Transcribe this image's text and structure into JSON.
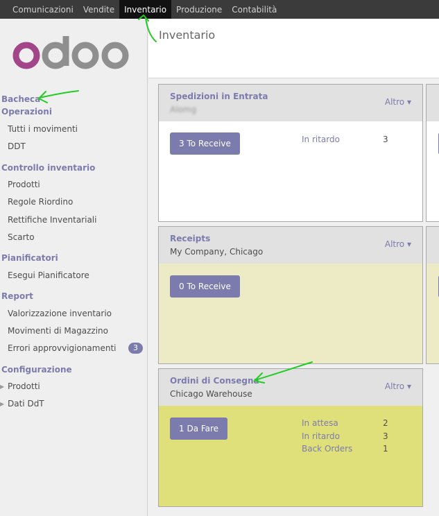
{
  "topbar": {
    "menus": [
      "Comunicazioni",
      "Vendite",
      "Inventario",
      "Produzione",
      "Contabilità"
    ]
  },
  "logo": {
    "text": "odoo",
    "colors": {
      "o1": "#a24689",
      "rest": "#8f8f8f"
    }
  },
  "sidebar": {
    "dashboard": "Bacheca",
    "operations": {
      "title": "Operazioni",
      "items": [
        "Tutti i movimenti",
        "DDT"
      ]
    },
    "inventory_control": {
      "title": "Controllo inventario",
      "items": [
        "Prodotti",
        "Regole Riordino",
        "Rettifiche Inventariali",
        "Scarto"
      ]
    },
    "schedulers": {
      "title": "Pianificatori",
      "items": [
        "Esegui Pianificatore"
      ]
    },
    "reports": {
      "title": "Report",
      "items": [
        "Valorizzazione inventario",
        "Movimenti di Magazzino",
        "Errori approvvigionamenti"
      ],
      "badge": "3"
    },
    "configuration": {
      "title": "Configurazione",
      "items": [
        "Prodotti",
        "Dati DdT"
      ]
    }
  },
  "main": {
    "title": "Inventario",
    "cards": [
      {
        "name": "Spedizioni in Entrata",
        "subtitle": "Alomg",
        "more": "Altro",
        "button": "3 To Receive",
        "stats": [
          {
            "label": "In ritardo",
            "value": "3"
          }
        ],
        "bg": "#ffffff"
      },
      {
        "name": "Receipts",
        "subtitle": "My Company, Chicago",
        "more": "Altro",
        "button": "0 To Receive",
        "stats": [],
        "bg": "#ecebc6"
      },
      {
        "name": "Ordini di Consegna",
        "subtitle": "Chicago Warehouse",
        "more": "Altro",
        "button": "1 Da Fare",
        "stats": [
          {
            "label": "In attesa",
            "value": "2"
          },
          {
            "label": "In ritardo",
            "value": "3"
          },
          {
            "label": "Back Orders",
            "value": "1"
          }
        ],
        "bg": "#e0e07b"
      }
    ]
  },
  "colors": {
    "accent": "#7c7bad",
    "topbar": "#3b3b3b",
    "annotation": "#22cc22"
  },
  "icons": {
    "dropdown": "caret-down-icon",
    "tree": "triangle-right-icon"
  }
}
